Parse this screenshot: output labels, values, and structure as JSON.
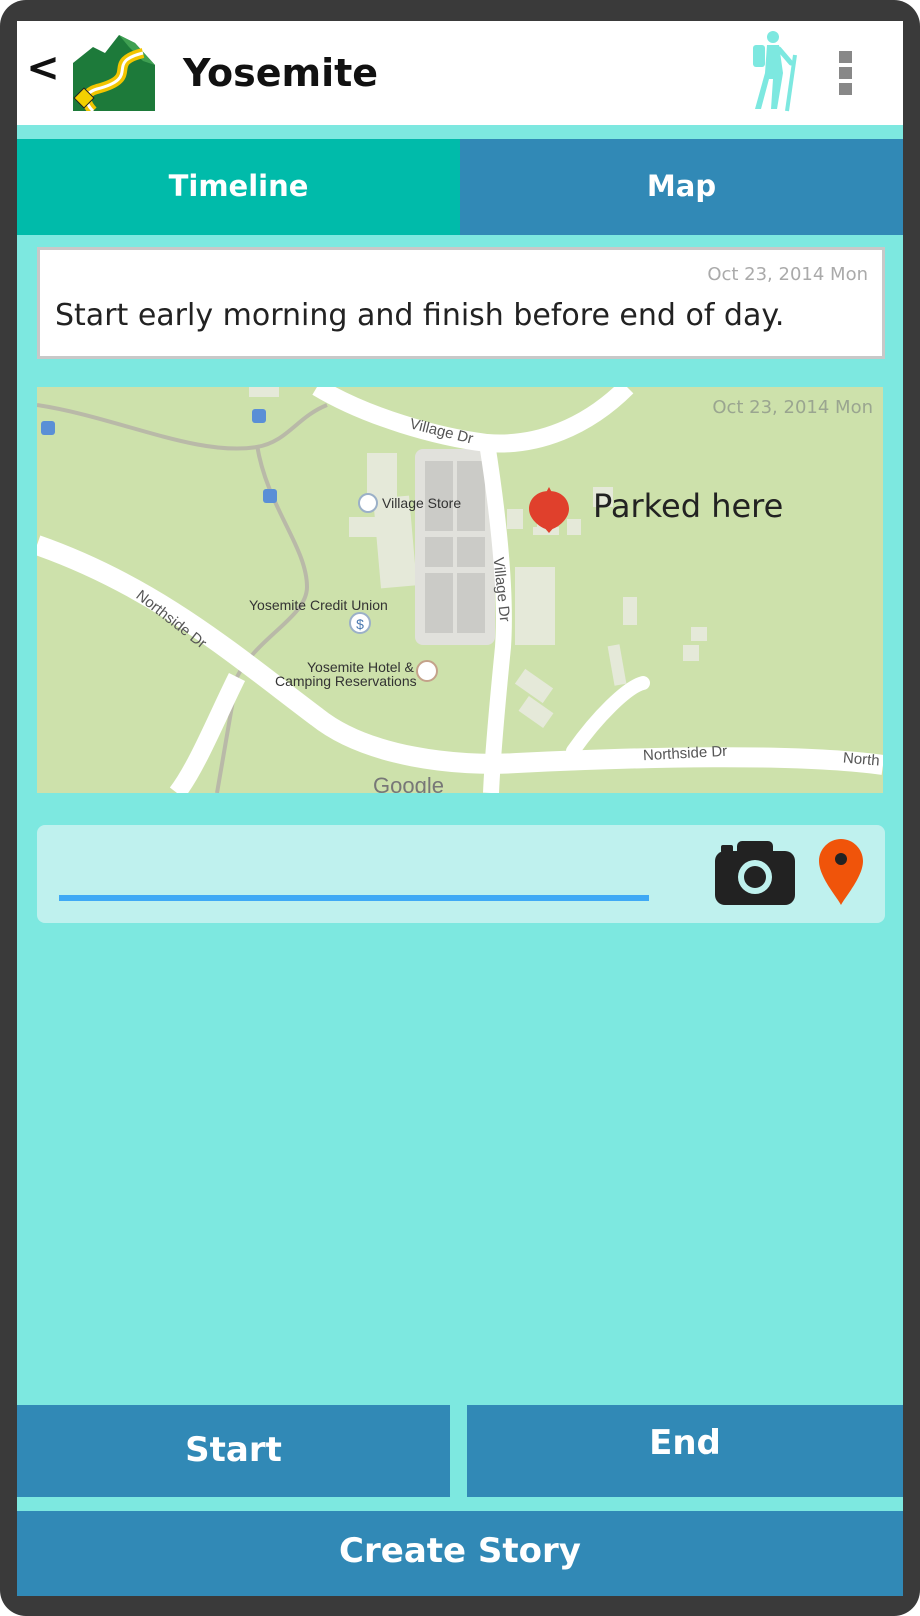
{
  "header": {
    "back_label": "<",
    "title": "Yosemite",
    "logo_icon": "mountain-road-logo-icon",
    "hiker_icon": "hiker-icon",
    "menu_icon": "overflow-menu-icon"
  },
  "tabs": [
    {
      "label": "Timeline",
      "active": true
    },
    {
      "label": "Map",
      "active": false
    }
  ],
  "timeline": {
    "note": {
      "date": "Oct 23, 2014 Mon",
      "text": "Start early morning and finish before end of day."
    },
    "map_entry": {
      "date": "Oct 23, 2014 Mon",
      "pin_label": "Parked here",
      "places": {
        "village_store": "Village Store",
        "credit_union": "Yosemite Credit Union",
        "hotel_line1": "Yosemite Hotel &",
        "hotel_line2": "Camping Reservations"
      },
      "roads": {
        "village_dr_top": "Village Dr",
        "village_dr_side": "Village Dr",
        "northside_left": "Northside Dr",
        "northside_bottom": "Northside Dr",
        "northside_right": "North"
      },
      "attribution": "Google"
    }
  },
  "composer": {
    "input_value": "",
    "input_placeholder": "",
    "camera_icon": "camera-icon",
    "location_icon": "location-pin-icon"
  },
  "actions": {
    "start_label": "Start",
    "end_label": "End",
    "create_story_label": "Create Story"
  },
  "colors": {
    "background": "#7de8e0",
    "active_tab": "#00bbaa",
    "primary_button": "#3189b6",
    "input_underline": "#3fa9f5",
    "pin": "#f0540a"
  }
}
